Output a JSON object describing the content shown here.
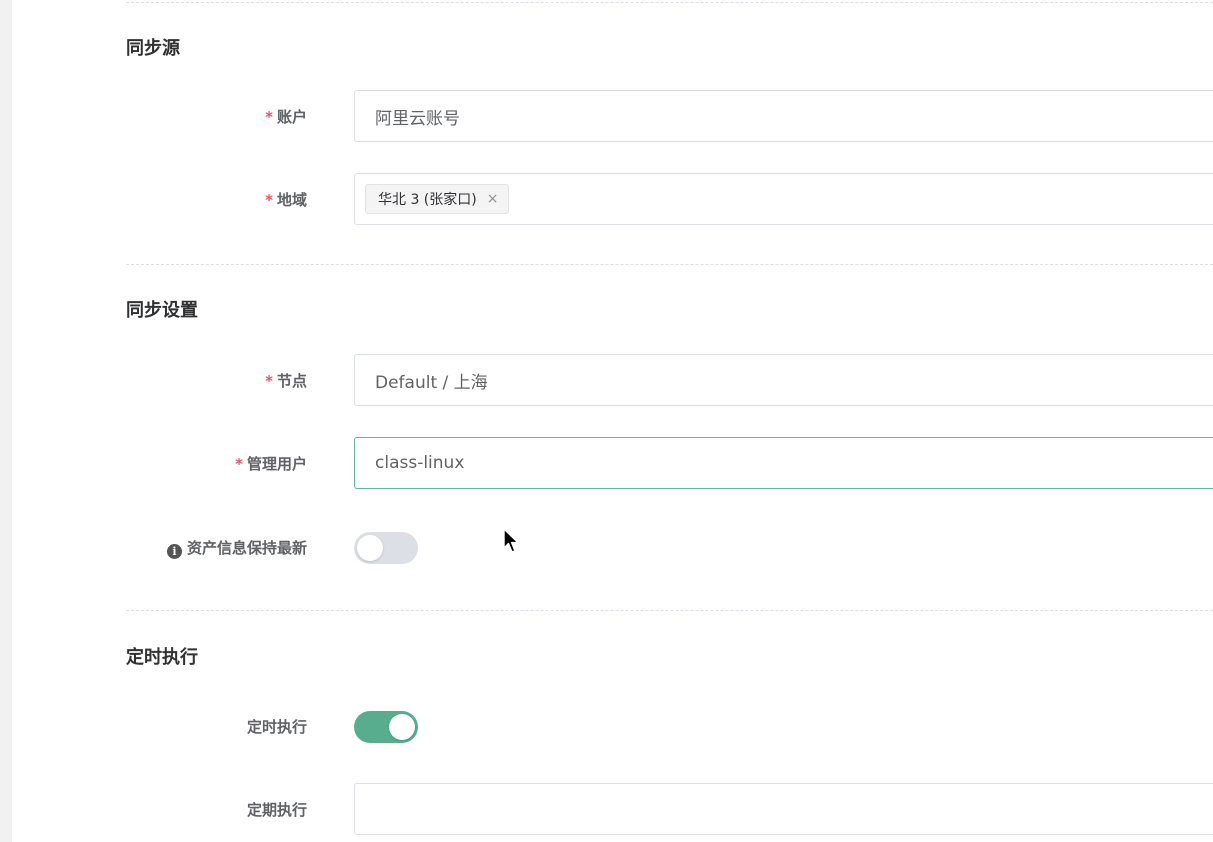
{
  "sections": {
    "source": {
      "title": "同步源",
      "account": {
        "label": "账户",
        "value": "阿里云账号"
      },
      "region": {
        "label": "地域",
        "tags": [
          {
            "text": "华北 3 (张家口)",
            "close": "×"
          }
        ]
      }
    },
    "settings": {
      "title": "同步设置",
      "node": {
        "label": "节点",
        "value": "Default / 上海"
      },
      "admin_user": {
        "label": "管理用户",
        "value": "class-linux"
      },
      "keep_latest": {
        "label": "资产信息保持最新",
        "info_glyph": "i",
        "enabled": false
      }
    },
    "schedule": {
      "title": "定时执行",
      "timed": {
        "label": "定时执行",
        "enabled": true
      },
      "periodic": {
        "label": "定期执行",
        "value": ""
      }
    }
  },
  "required_mark": "*",
  "colors": {
    "accent": "#58ad8e",
    "required": "#ed5565",
    "switch_off": "#dcdfe6",
    "focus_border": "#67b399"
  }
}
